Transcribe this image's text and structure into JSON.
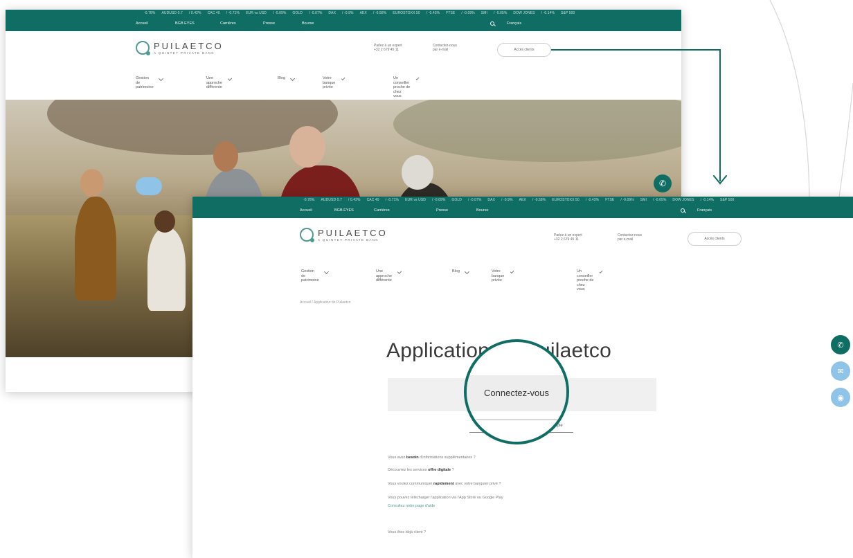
{
  "ticker": {
    "items": [
      "-0.78%",
      "AUDUSD 0.7",
      "/ 0.42%",
      "CAC 40",
      "/ -0.71%",
      "EUR vs USD",
      "/ -0.09%",
      "GOLD",
      "/ -0.07%",
      "DAX",
      "/ -0.9%",
      "AEX",
      "/ -0.58%",
      "EUROSTOXX 50",
      "/ -0.43%",
      "FTSE",
      "/ -0.09%",
      "SMI",
      "/ -0.65%",
      "DOW JONES",
      "/ -0.14%",
      "S&P 500"
    ]
  },
  "topnav": {
    "links": [
      "Accueil",
      "BGB EYES",
      "Carrières",
      "Presse",
      "Bourse"
    ],
    "language": "Français"
  },
  "brand": {
    "name": "PUILAETCO",
    "tagline": "A QUINTET PRIVATE BANK"
  },
  "contact": {
    "phone_label": "Parlez à un expert",
    "phone_number": "+32 2 679 45 11",
    "contact_label": "Contactez-nous",
    "contact_sub": "par e-mail"
  },
  "header": {
    "access_button": "Accès clients"
  },
  "mainnav": [
    {
      "line1": "Gestion de",
      "line2": "patrimoine"
    },
    {
      "line1": "Une approche",
      "line2": "différente"
    },
    {
      "line1": "Blog",
      "line2": ""
    },
    {
      "line1": "Votre banque",
      "line2": "privée"
    },
    {
      "line1": "Un conseiller proche de chez",
      "line2": "vous"
    }
  ],
  "page2": {
    "breadcrumb": "Accueil  /  Application de Puilaetco",
    "title": "Application de Puilaetco",
    "login_button": "Connectez-vous",
    "sub_link": "Créer un compte",
    "paragraphs": [
      {
        "pre": "Vous avez ",
        "bold": "besoin",
        "post": " d'informations supplémentaires ?"
      },
      {
        "pre": "Découvrez les services ",
        "bold": "offre digitale",
        "post": " ?"
      },
      {
        "pre": "Vous voulez communiquer ",
        "bold": "rapidement",
        "post": " avec votre banquier privé ?"
      },
      {
        "pre": "Vous pouvez télécharger l'application via l'App Store ou Google Play",
        "bold": "",
        "post": ""
      }
    ],
    "link_line": "Consultez notre page d'aide",
    "footer_link": "Vous êtes déjà client ?"
  },
  "colors": {
    "brand_green": "#0f6d63",
    "logo_green": "#4f9b92",
    "fab_light_blue": "#8fc3e8"
  }
}
